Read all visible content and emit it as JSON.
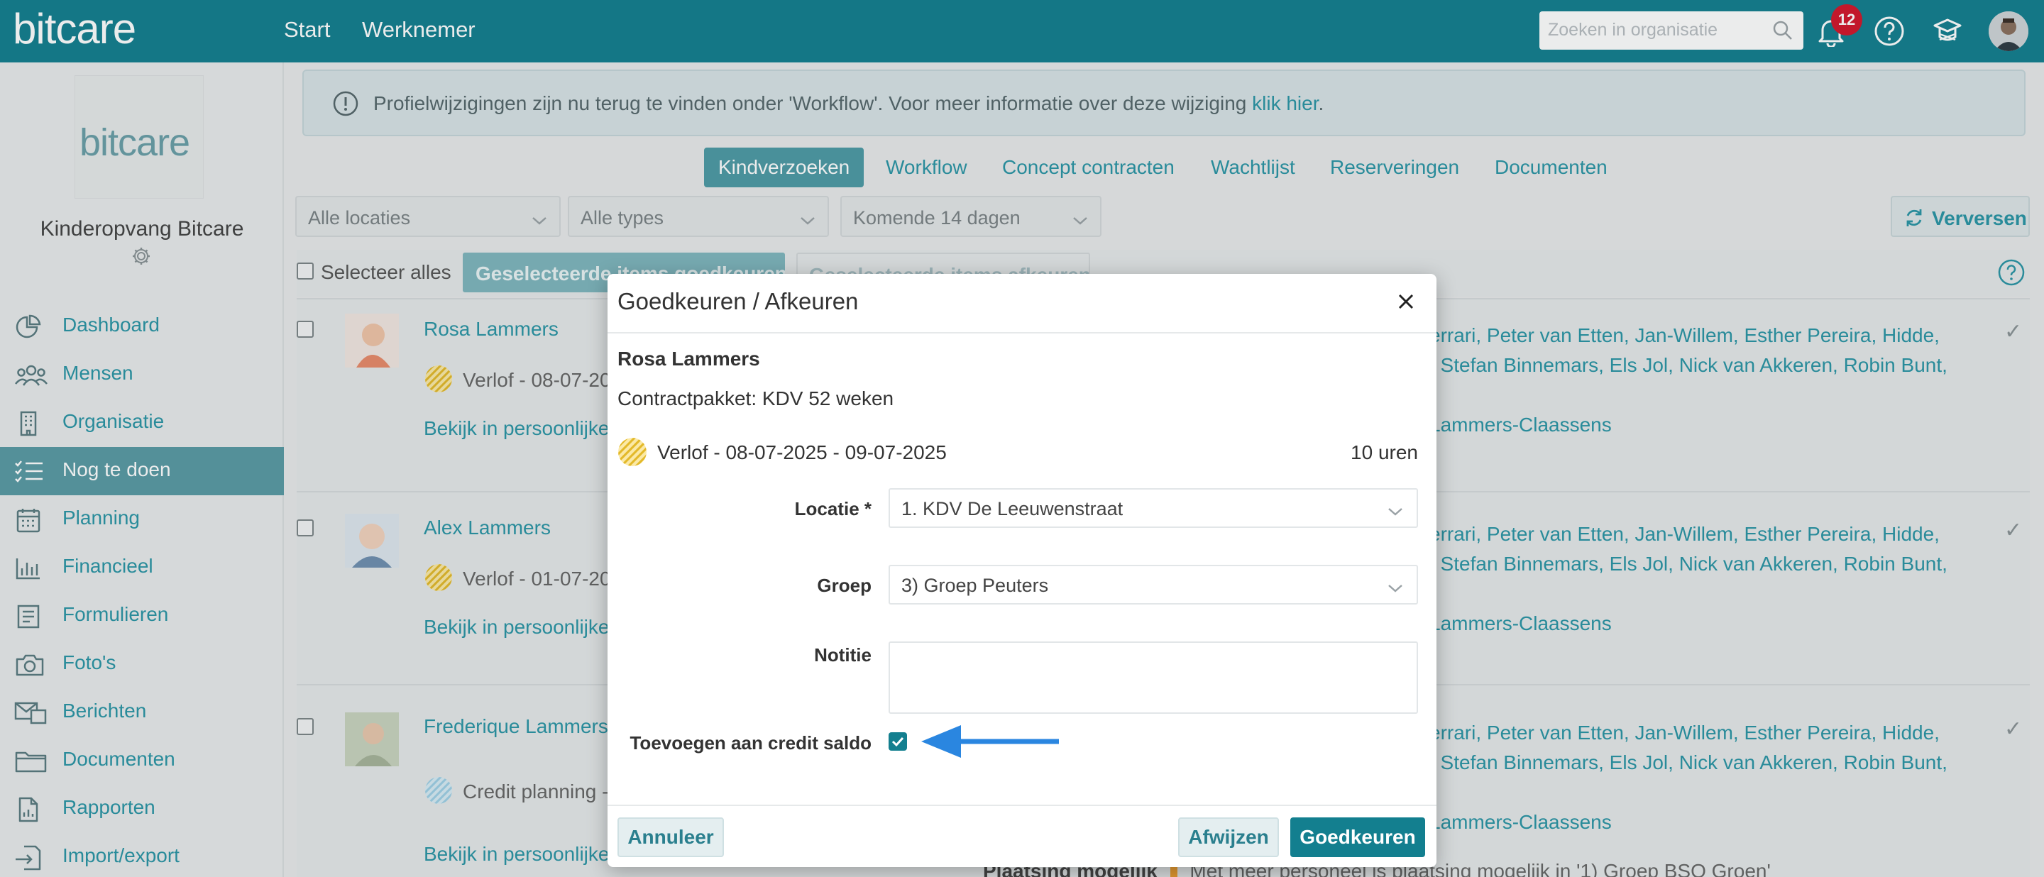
{
  "header": {
    "brand": "bitcare",
    "nav": [
      "Start",
      "Werknemer"
    ],
    "search_placeholder": "Zoeken in organisatie",
    "notification_count": "12"
  },
  "sidebar": {
    "org_logo": "bitcare",
    "org_name": "Kinderopvang Bitcare",
    "items": [
      {
        "label": "Dashboard",
        "icon": "pie-chart-icon"
      },
      {
        "label": "Mensen",
        "icon": "people-icon"
      },
      {
        "label": "Organisatie",
        "icon": "building-icon"
      },
      {
        "label": "Nog te doen",
        "icon": "checklist-icon",
        "active": true
      },
      {
        "label": "Planning",
        "icon": "calendar-icon"
      },
      {
        "label": "Financieel",
        "icon": "bar-chart-icon"
      },
      {
        "label": "Formulieren",
        "icon": "form-icon"
      },
      {
        "label": "Foto's",
        "icon": "camera-icon"
      },
      {
        "label": "Berichten",
        "icon": "messages-icon"
      },
      {
        "label": "Documenten",
        "icon": "folder-icon"
      },
      {
        "label": "Rapporten",
        "icon": "report-icon"
      },
      {
        "label": "Import/export",
        "icon": "import-icon"
      }
    ]
  },
  "banner": {
    "text": "Profielwijzigingen zijn nu terug te vinden onder 'Workflow'. Voor meer informatie over deze wijziging",
    "link": "klik hier",
    "end": "."
  },
  "tabs": [
    "Kindverzoeken",
    "Workflow",
    "Concept contracten",
    "Wachtlijst",
    "Reserveringen",
    "Documenten"
  ],
  "filters": {
    "location": "Alle locaties",
    "type": "Alle types",
    "period": "Komende 14 dagen",
    "refresh": "Verversen"
  },
  "bulk": {
    "select_all": "Selecteer alles",
    "approve_selected": "Geselecteerde items goedkeuren",
    "reject_selected": "Geselecteerde items afkeuren"
  },
  "rows": [
    {
      "name": "Rosa Lammers",
      "request": "Verlof - 08-07-20",
      "link": "Bekijk in persoonlijke",
      "recipients_1": "errari, Peter van Etten, Jan-Willem, Esther Pereira, Hidde,",
      "recipients_2": ", Stefan Binnemars, Els Jol, Nick van Akkeren, Robin Bunt,",
      "recipients_3": "Lammers-Claassens"
    },
    {
      "name": "Alex Lammers",
      "request": "Verlof - 01-07-20",
      "link": "Bekijk in persoonlijke",
      "recipients_1": "errari, Peter van Etten, Jan-Willem, Esther Pereira, Hidde,",
      "recipients_2": ", Stefan Binnemars, Els Jol, Nick van Akkeren, Robin Bunt,",
      "recipients_3": "Lammers-Claassens"
    },
    {
      "name": "Frederique Lammers",
      "request": "Credit planning -",
      "link": "Bekijk in persoonlijke",
      "recipients_1": "errari, Peter van Etten, Jan-Willem, Esther Pereira, Hidde,",
      "recipients_2": ", Stefan Binnemars, Els Jol, Nick van Akkeren, Robin Bunt,",
      "recipients_3": "Lammers-Claassens"
    }
  ],
  "footer_note": {
    "label": "Plaatsing mogelijk",
    "text": "Met meer personeel is plaatsing mogelijk in '1) Groep BSO Groen'"
  },
  "modal": {
    "title": "Goedkeuren / Afkeuren",
    "child_name": "Rosa Lammers",
    "contract": "Contractpakket: KDV 52 weken",
    "request": "Verlof - 08-07-2025 - 09-07-2025",
    "hours": "10 uren",
    "location_label": "Locatie *",
    "location_value": "1. KDV De Leeuwenstraat",
    "group_label": "Groep",
    "group_value": "3) Groep Peuters",
    "note_label": "Notitie",
    "credit_label": "Toevoegen aan credit saldo",
    "credit_checked": true,
    "cancel": "Annuleer",
    "reject": "Afwijzen",
    "approve": "Goedkeuren"
  }
}
